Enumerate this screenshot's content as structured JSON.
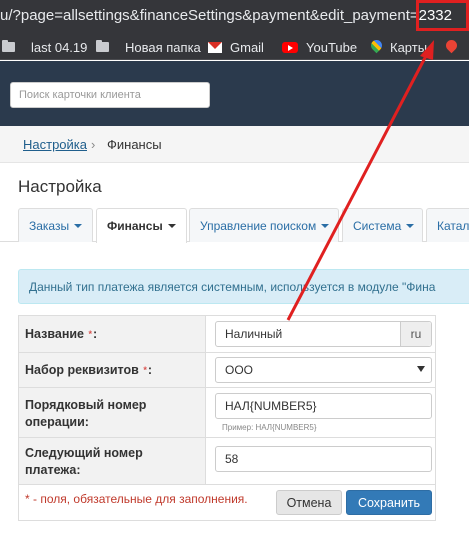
{
  "browser": {
    "url_prefix": "u/?page=allsettings&financeSettings&payment&edit_payment=",
    "url_id": "2332",
    "bookmarks": [
      {
        "label": "last 04.19",
        "icon": "folder-icon"
      },
      {
        "label": "Новая папка",
        "icon": "folder-icon"
      },
      {
        "label": "Gmail",
        "icon": "gmail-icon"
      },
      {
        "label": "YouTube",
        "icon": "youtube-icon"
      },
      {
        "label": "Карты",
        "icon": "maps-icon"
      },
      {
        "label": "",
        "icon": "pin-icon"
      }
    ]
  },
  "header": {
    "search_placeholder": "Поиск карточки клиента"
  },
  "breadcrumb": {
    "link": "Настройка",
    "separator": "›",
    "current": "Финансы"
  },
  "page_title": "Настройка",
  "tabs": [
    {
      "label": "Заказы",
      "active": false
    },
    {
      "label": "Финансы",
      "active": true
    },
    {
      "label": "Управление поиском",
      "active": false
    },
    {
      "label": "Система",
      "active": false
    },
    {
      "label": "Катал",
      "active": false
    }
  ],
  "alert": {
    "text": "Данный тип платежа является системным, используется в модуле \"Фина"
  },
  "form": {
    "name_label": "Название",
    "name_value": "Наличный",
    "name_lang": "ru",
    "requisites_label": "Набор реквизитов",
    "requisites_value": "ООО",
    "order_number_label_1": "Порядковый номер",
    "order_number_label_2": "операции:",
    "order_number_value": "НАЛ{NUMBER5}",
    "order_number_hint": "Пример: НАЛ{NUMBER5}",
    "next_number_label_1": "Следующий номер",
    "next_number_label_2": "платежа:",
    "next_number_value": "58",
    "required_mark": "*",
    "colon": ":",
    "footer_note": "* - поля, обязательные для заполнения.",
    "cancel_label": "Отмена",
    "save_label": "Сохранить"
  },
  "colors": {
    "header_bg": "#2b3a4d",
    "accent_blue": "#337ab7",
    "alert_bg": "#d9edf7",
    "annotation_red": "#e02020",
    "required_red": "#d9534f"
  }
}
